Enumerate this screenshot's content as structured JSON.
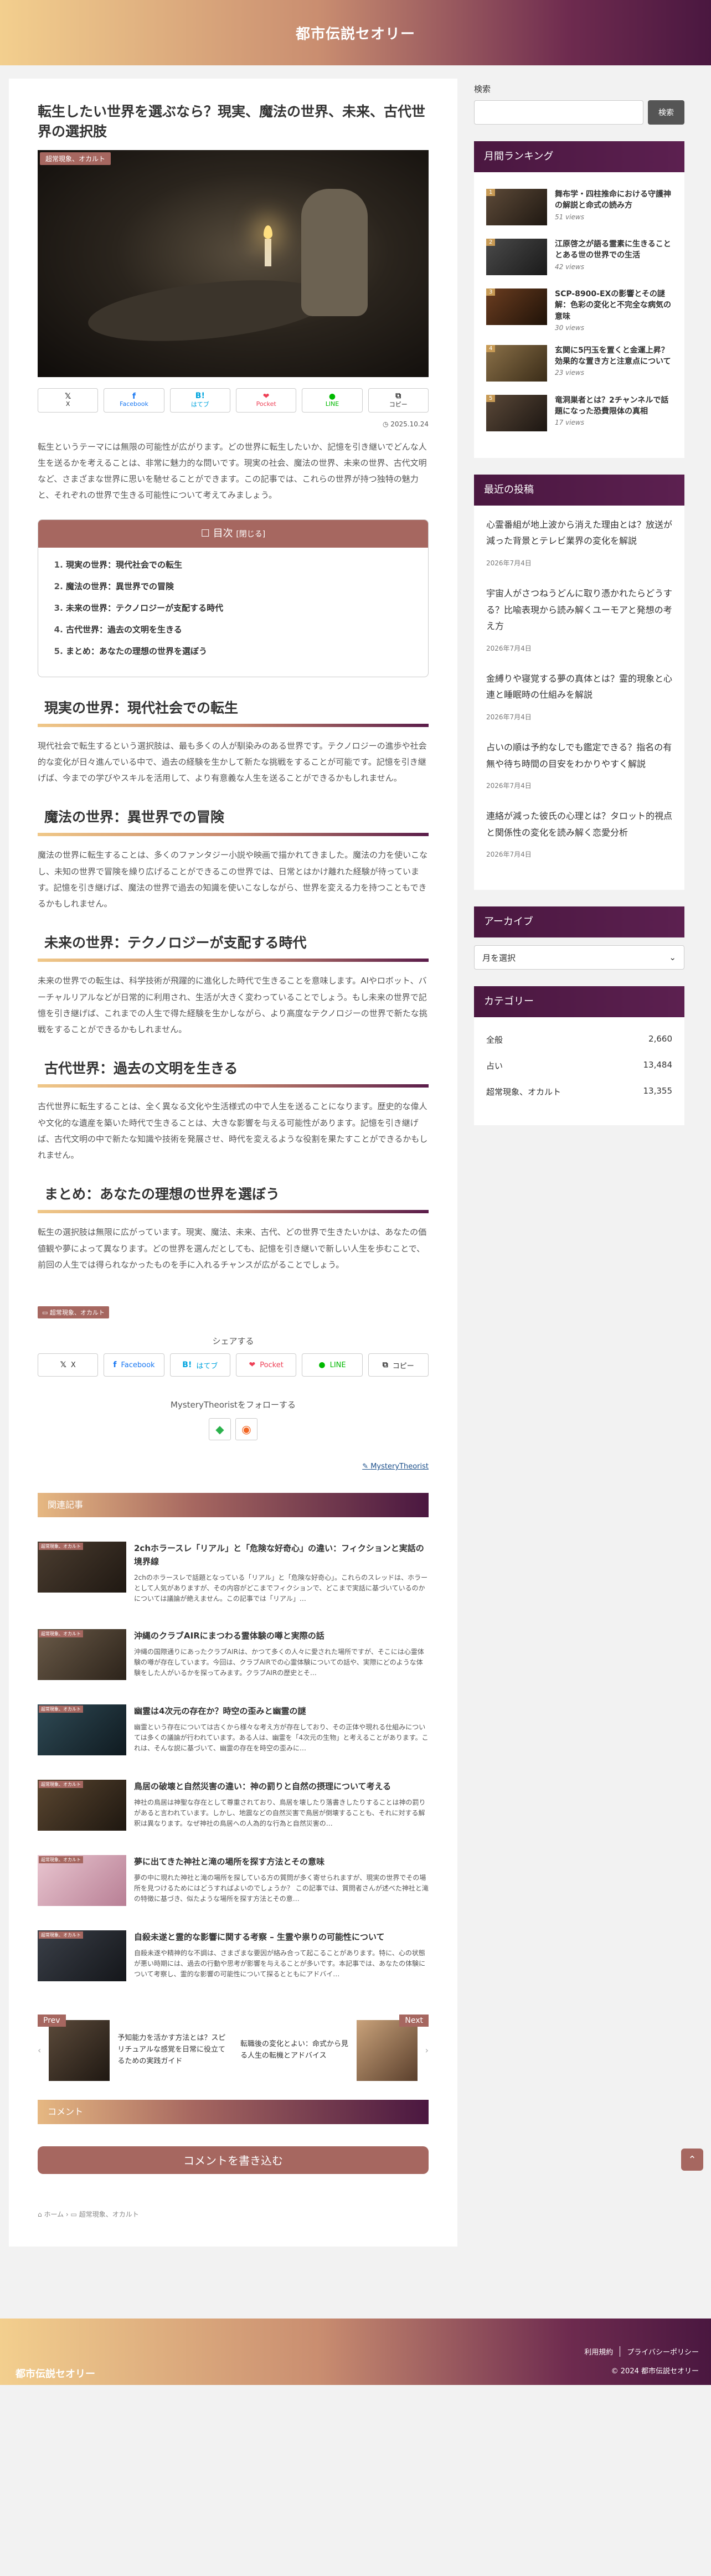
{
  "site": {
    "title": "都市伝説セオリー"
  },
  "article": {
    "title": "転生したい世界を選ぶなら？現実、魔法の世界、未来、古代世界の選択肢",
    "category_badge": "超常現象、オカルト",
    "date": "2025.10.24",
    "intro": "転生というテーマには無限の可能性が広がります。どの世界に転生したいか、記憶を引き継いでどんな人生を送るかを考えることは、非常に魅力的な問いです。現実の社会、魔法の世界、未来の世界、古代文明など、さまざまな世界に思いを馳せることができます。この記事では、これらの世界が持つ独特の魅力と、それぞれの世界で生きる可能性について考えてみましょう。",
    "toc": {
      "title": "目次",
      "toggle": "[閉じる]",
      "items": [
        "現実の世界：現代社会での転生",
        "魔法の世界：異世界での冒険",
        "未来の世界：テクノロジーが支配する時代",
        "古代世界：過去の文明を生きる",
        "まとめ：あなたの理想の世界を選ぼう"
      ]
    },
    "sections": [
      {
        "heading": "現実の世界：現代社会での転生",
        "body": "現代社会で転生するという選択肢は、最も多くの人が馴染みのある世界です。テクノロジーの進歩や社会的な変化が日々進んでいる中で、過去の経験を生かして新たな挑戦をすることが可能です。記憶を引き継げば、今までの学びやスキルを活用して、より有意義な人生を送ることができるかもしれません。"
      },
      {
        "heading": "魔法の世界：異世界での冒険",
        "body": "魔法の世界に転生することは、多くのファンタジー小説や映画で描かれてきました。魔法の力を使いこなし、未知の世界で冒険を繰り広げることができるこの世界では、日常とはかけ離れた経験が待っています。記憶を引き継げば、魔法の世界で過去の知識を使いこなしながら、世界を変える力を持つこともできるかもしれません。"
      },
      {
        "heading": "未来の世界：テクノロジーが支配する時代",
        "body": "未来の世界での転生は、科学技術が飛躍的に進化した時代で生きることを意味します。AIやロボット、バーチャルリアルなどが日常的に利用され、生活が大きく変わっていることでしょう。もし未来の世界で記憶を引き継げば、これまでの人生で得た経験を生かしながら、より高度なテクノロジーの世界で新たな挑戦をすることができるかもしれません。"
      },
      {
        "heading": "古代世界：過去の文明を生きる",
        "body": "古代世界に転生することは、全く異なる文化や生活様式の中で人生を送ることになります。歴史的な偉人や文化的な遺産を築いた時代で生きることは、大きな影響を与える可能性があります。記憶を引き継げば、古代文明の中で新たな知識や技術を発展させ、時代を変えるような役割を果たすことができるかもしれません。"
      },
      {
        "heading": "まとめ：あなたの理想の世界を選ぼう",
        "body": "転生の選択肢は無限に広がっています。現実、魔法、未来、古代、どの世界で生きたいかは、あなたの価値観や夢によって異なります。どの世界を選んだとしても、記憶を引き継いで新しい人生を歩むことで、前回の人生では得られなかったものを手に入れるチャンスが広がることでしょう。"
      }
    ],
    "tag": "超常現象、オカルト"
  },
  "share": {
    "x": "X",
    "facebook": "Facebook",
    "hatena": "はてブ",
    "pocket": "Pocket",
    "line": "LINE",
    "copy": "コピー",
    "label": "シェアする"
  },
  "follow": {
    "label": "MysteryTheoristをフォローする"
  },
  "author": "MysteryTheorist",
  "related": {
    "heading": "関連記事",
    "items": [
      {
        "title": "2chホラースレ「リアル」と「危険な好奇心」の違い：フィクションと実話の境界線",
        "desc": "2chのホラースレで話題となっている「リアル」と「危険な好奇心」。これらのスレッドは、ホラーとして人気がありますが、その内容がどこまでフィクションで、どこまで実話に基づいているのかについては議論が絶えません。この記事では「リアル」…"
      },
      {
        "title": "沖縄のクラブAIRにまつわる霊体験の噂と実際の話",
        "desc": "沖縄の国際通りにあったクラブAIRは、かつて多くの人々に愛された場所ですが、そこには心霊体験の噂が存在しています。今回は、クラブAIRでの心霊体験についての話や、実際にどのような体験をした人がいるかを探ってみます。クラブAIRの歴史とそ…"
      },
      {
        "title": "幽霊は4次元の存在か？時空の歪みと幽霊の謎",
        "desc": "幽霊という存在については古くから様々な考え方が存在しており、その正体や現れる仕組みについては多くの議論が行われています。ある人は、幽霊を「4次元の生物」と考えることがあります。これは、そんな説に基づいて、幽霊の存在を時空の歪みに…"
      },
      {
        "title": "鳥居の破壊と自然災害の違い：神の罰りと自然の摂理について考える",
        "desc": "神社の鳥居は神聖な存在として尊重されており、鳥居を壊したり落書きしたりすることは神の罰りがあると言われています。しかし、地震などの自然災害で鳥居が倒壊することも、それに対する解釈は異なります。なぜ神社の鳥居への人為的な行為と自然災害の…"
      },
      {
        "title": "夢に出てきた神社と滝の場所を探す方法とその意味",
        "desc": "夢の中に現れた神社と滝の場所を探している方の質問が多く寄せられますが、現実の世界でその場所を見つけるためにはどうすればよいのでしょうか？ この記事では、質問者さんが述べた神社と滝の特徴に基づき、似たような場所を探す方法とその意…"
      },
      {
        "title": "自殺未遂と霊的な影響に関する考察 – 生霊や祟りの可能性について",
        "desc": "自殺未遂や精神的な不調は、さまざまな要因が絡み合って起こることがあります。特に、心の状態が悪い時期には、過去の行動や思考が影響を与えることが多いです。本記事では、あなたの体験について考察し、霊的な影響の可能性について探るとともにアドバイ…"
      }
    ]
  },
  "pager": {
    "prev_label": "Prev",
    "prev_title": "予知能力を活かす方法とは？スピリチュアルな感覚を日常に役立てるための実践ガイド",
    "next_label": "Next",
    "next_title": "転職後の変化とよい：命式から見る人生の転機とアドバイス"
  },
  "comments": {
    "heading": "コメント",
    "button": "コメントを書き込む"
  },
  "breadcrumb": {
    "home": "ホーム",
    "category": "超常現象、オカルト"
  },
  "sidebar": {
    "search_label": "検索",
    "search_button": "検索",
    "ranking": {
      "heading": "月間ランキング",
      "items": [
        {
          "num": "1",
          "title": "舞布学・四柱推命における守護神の解説と命式の読み方",
          "views": "51 views"
        },
        {
          "num": "2",
          "title": "江原啓之が語る霊素に生きることとある世の世界での生活",
          "views": "42 views"
        },
        {
          "num": "3",
          "title": "SCP-8900-EXの影響とその謎解：色彩の変化と不完全な病気の意味",
          "views": "30 views"
        },
        {
          "num": "4",
          "title": "玄関に5円玉を置くと金運上昇？効果的な置き方と注意点について",
          "views": "23 views"
        },
        {
          "num": "5",
          "title": "竜洞巣者とは？2チャンネルで話題になった恐費限体の真相",
          "views": "17 views"
        }
      ]
    },
    "recent": {
      "heading": "最近の投稿",
      "items": [
        {
          "title": "心霊番組が地上波から消えた理由とは？放送が減った背景とテレビ業界の変化を解説",
          "date": "2026年7月4日"
        },
        {
          "title": "宇宙人がさつねうどんに取り憑かれたらどうする？比喩表現から読み解くユーモアと発想の考え方",
          "date": "2026年7月4日"
        },
        {
          "title": "金縛りや寝覚する夢の真体とは？霊的現象と心連と睡眠時の仕組みを解説",
          "date": "2026年7月4日"
        },
        {
          "title": "占いの順は予約なしでも鑑定できる？指名の有無や待ち時間の目安をわかりやすく解説",
          "date": "2026年7月4日"
        },
        {
          "title": "連絡が減った彼氏の心理とは？タロット的視点と関係性の変化を読み解く恋愛分析",
          "date": "2026年7月4日"
        }
      ]
    },
    "archive": {
      "heading": "アーカイブ",
      "select": "月を選択"
    },
    "categories": {
      "heading": "カテゴリー",
      "items": [
        {
          "name": "全般",
          "count": "2,660"
        },
        {
          "name": "占い",
          "count": "13,484"
        },
        {
          "name": "超常現象、オカルト",
          "count": "13,355"
        }
      ]
    }
  },
  "footer": {
    "title": "都市伝説セオリー",
    "link1": "利用規約",
    "link2": "プライバシーポリシー",
    "copyright": "© 2024 都市伝説セオリー"
  }
}
